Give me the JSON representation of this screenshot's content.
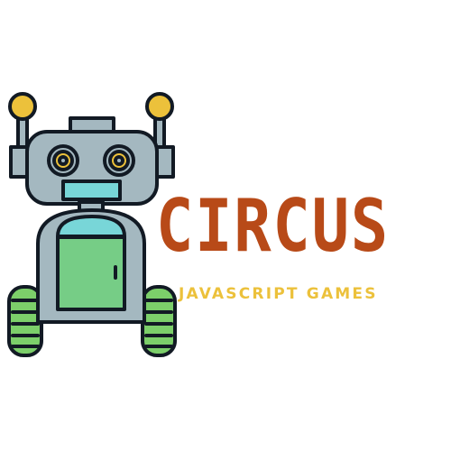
{
  "brand": {
    "title": "CIRCUS",
    "tagline": "JAVASCRIPT GAMES"
  },
  "logo": {
    "icon": "robot-icon"
  },
  "colors": {
    "background": "#ffffff",
    "title": "#b84a18",
    "tagline": "#ecc13b",
    "robot_body": "#a4b8c0",
    "outline": "#121a24",
    "antenna_ball": "#ecc13b",
    "eye_iris": "#ecc13b",
    "mouth_and_dome": "#78d6d8",
    "door": "#76cd86",
    "wheels": "#7ccf6a"
  }
}
